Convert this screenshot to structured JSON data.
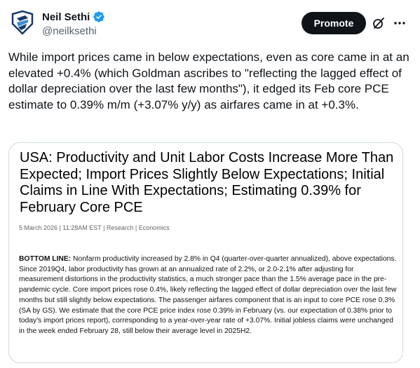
{
  "author": {
    "name": "Neil Sethi",
    "handle": "@neilksethi",
    "verified_icon": "verified-badge-icon",
    "avatar_colors": {
      "dark": "#1a3a6b",
      "light": "#3c8fd6"
    }
  },
  "header": {
    "promote_label": "Promote",
    "grok_icon": "slash-circle-icon",
    "more_icon": "more-icon"
  },
  "tweet": {
    "text": "While import prices came in below expectations, even as core came in at an elevated +0.4% (which Goldman ascribes to \"reflecting the lagged effect of dollar depreciation over the last few months\"), it edged its Feb core PCE estimate to 0.39% m/m (+3.07% y/y) as airfares came in at +0.3%."
  },
  "card": {
    "title": "USA: Productivity and Unit Labor Costs Increase More Than Expected; Import Prices Slightly Below Expectations; Initial Claims in Line With Expectations; Estimating 0.39% for February Core PCE",
    "meta": "5 March 2026 | 11:28AM EST | Research | Economics",
    "body_label": "BOTTOM LINE:",
    "body_text": " Nonfarm productivity increased by 2.8% in Q4 (quarter-over-quarter annualized), above expectations. Since 2019Q4, labor productivity has grown at an annualized rate of 2.2%, or 2.0-2.1% after adjusting for measurement distortions in the productivity statistics, a much stronger pace than the 1.5% average pace in the pre-pandemic cycle. Core import prices rose 0.4%, likely reflecting the lagged effect of dollar depreciation over the last few months but still slightly below expectations. The passenger airfares component that is an input to core PCE rose 0.3% (SA by GS). We estimate that the core PCE price index rose 0.39% in February (vs. our expectation of 0.38% prior to today's import prices report), corresponding to a year-over-year rate of +3.07%. Initial jobless claims were unchanged in the week ended February 28, still below their average level in 2025H2."
  }
}
